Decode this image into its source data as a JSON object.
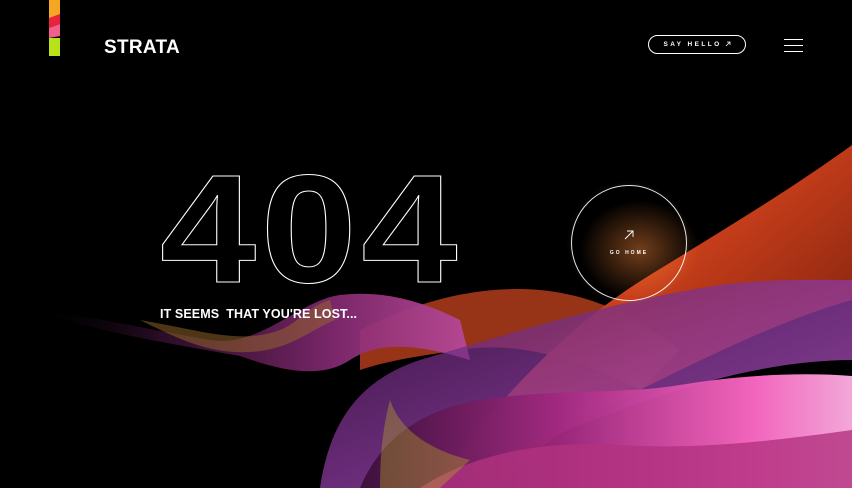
{
  "brand": {
    "name": "STRATA"
  },
  "header": {
    "say_hello_label": "SAY HELLO",
    "say_hello_icon": "arrow-up-right-icon",
    "menu_icon": "hamburger-menu-icon"
  },
  "error": {
    "code": "404",
    "message": "IT SEEMS  THAT YOU'RE LOST..."
  },
  "go_home": {
    "label": "GO HOME",
    "icon": "arrow-up-right-icon"
  },
  "colors": {
    "background": "#000000",
    "logo_stripes": [
      "#f5a623",
      "#e8233a",
      "#f0608a",
      "#b9e21b"
    ],
    "wave_orange": "#e0501e",
    "wave_magenta": "#d6369a",
    "wave_purple": "#7a2b8f"
  }
}
